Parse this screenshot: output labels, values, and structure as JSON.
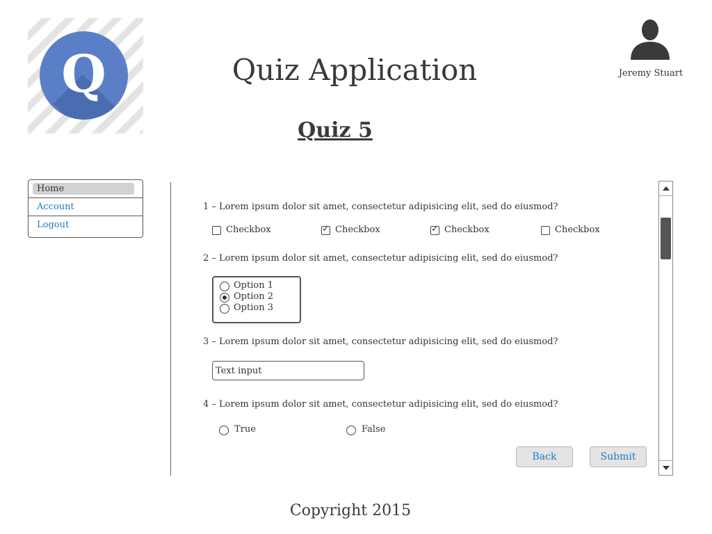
{
  "header": {
    "logo_letter": "Q",
    "app_title": "Quiz Application",
    "quiz_title": "Quiz 5",
    "user_name": "Jeremy Stuart"
  },
  "nav": {
    "items": [
      {
        "label": "Home",
        "selected": true
      },
      {
        "label": "Account",
        "selected": false
      },
      {
        "label": "Logout",
        "selected": false
      }
    ]
  },
  "questions": [
    {
      "text": "1 – Lorem ipsum dolor sit amet, consectetur adipisicing elit, sed do eiusmod?",
      "type": "checkbox",
      "options": [
        {
          "label": "Checkbox",
          "checked": false
        },
        {
          "label": "Checkbox",
          "checked": true
        },
        {
          "label": "Checkbox",
          "checked": true
        },
        {
          "label": "Checkbox",
          "checked": false
        }
      ]
    },
    {
      "text": "2 – Lorem ipsum dolor sit amet, consectetur adipisicing elit, sed do eiusmod?",
      "type": "radio-group",
      "options": [
        {
          "label": "Option 1",
          "selected": false
        },
        {
          "label": "Option 2",
          "selected": true
        },
        {
          "label": "Option 3",
          "selected": false
        }
      ]
    },
    {
      "text": "3 – Lorem ipsum dolor sit amet, consectetur adipisicing elit, sed do eiusmod?",
      "type": "text",
      "input_value": "Text input"
    },
    {
      "text": "4 – Lorem ipsum dolor sit amet, consectetur adipisicing elit, sed do eiusmod?",
      "type": "true-false",
      "options": [
        {
          "label": "True",
          "selected": false
        },
        {
          "label": "False",
          "selected": false
        }
      ]
    }
  ],
  "actions": {
    "back_label": "Back",
    "submit_label": "Submit"
  },
  "footer": {
    "copyright": "Copyright 2015"
  },
  "colors": {
    "logo_blue": "#5b7fc7",
    "link_blue": "#1a7bbf",
    "text": "#333333"
  },
  "icons": {
    "user": "user-avatar-icon",
    "checkbox": "checkbox-icon",
    "radio": "radio-icon",
    "scroll_up": "scroll-up-arrow-icon",
    "scroll_down": "scroll-down-arrow-icon"
  }
}
